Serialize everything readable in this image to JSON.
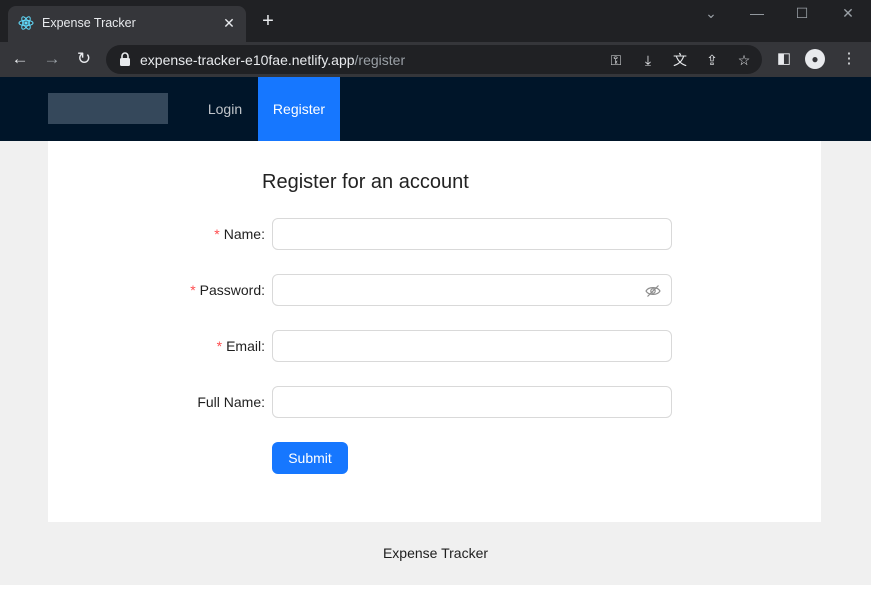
{
  "browser": {
    "tab_title": "Expense Tracker",
    "new_tab_glyph": "+",
    "close_glyph": "✕",
    "url_host": "expense-tracker-e10fae.netlify.app",
    "url_path": "/register",
    "icons": [
      "back-icon",
      "forward-icon",
      "reload-icon",
      "lock-icon",
      "key-icon",
      "install-icon",
      "translate-icon",
      "share-icon",
      "star-icon",
      "sidepanel-icon",
      "profile-icon",
      "menu-icon"
    ]
  },
  "nav": {
    "items": [
      {
        "label": "Login",
        "active": false
      },
      {
        "label": "Register",
        "active": true
      }
    ]
  },
  "form": {
    "title": "Register for an account",
    "fields": [
      {
        "label": "Name",
        "required": true,
        "value": "",
        "placeholder": ""
      },
      {
        "label": "Password",
        "required": true,
        "value": "",
        "placeholder": ""
      },
      {
        "label": "Email",
        "required": true,
        "value": "",
        "placeholder": ""
      },
      {
        "label": "Full Name",
        "required": false,
        "value": "",
        "placeholder": ""
      }
    ],
    "required_mark": "*",
    "label_suffix": ":",
    "submit_label": "Submit"
  },
  "footer": {
    "text": "Expense Tracker"
  },
  "colors": {
    "header_bg": "#001529",
    "accent": "#1677ff",
    "required": "#ff4d4f"
  }
}
